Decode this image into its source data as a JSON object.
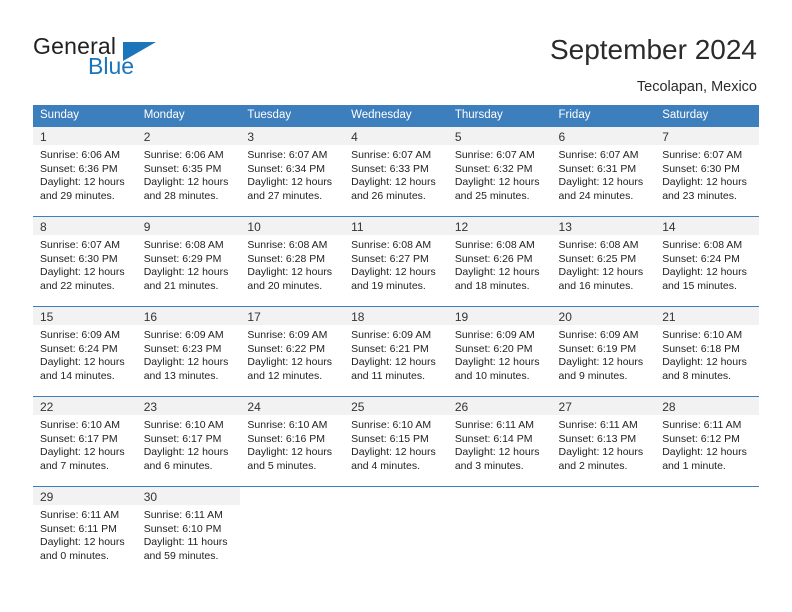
{
  "brand": {
    "name_top": "General",
    "name_bottom": "Blue",
    "triangle_color": "#1b75bb",
    "text_color": "#231f20"
  },
  "header": {
    "title": "September 2024",
    "subtitle": "Tecolapan, Mexico"
  },
  "theme": {
    "header_bg": "#3d7ebd",
    "header_text": "#ffffff",
    "daynum_band": "#f2f2f2",
    "row_divider": "#3d7ebd",
    "body_text": "#222222"
  },
  "weekdays": [
    "Sunday",
    "Monday",
    "Tuesday",
    "Wednesday",
    "Thursday",
    "Friday",
    "Saturday"
  ],
  "weeks": [
    [
      {
        "day": "1",
        "sunrise": "Sunrise: 6:06 AM",
        "sunset": "Sunset: 6:36 PM",
        "daylight1": "Daylight: 12 hours",
        "daylight2": "and 29 minutes."
      },
      {
        "day": "2",
        "sunrise": "Sunrise: 6:06 AM",
        "sunset": "Sunset: 6:35 PM",
        "daylight1": "Daylight: 12 hours",
        "daylight2": "and 28 minutes."
      },
      {
        "day": "3",
        "sunrise": "Sunrise: 6:07 AM",
        "sunset": "Sunset: 6:34 PM",
        "daylight1": "Daylight: 12 hours",
        "daylight2": "and 27 minutes."
      },
      {
        "day": "4",
        "sunrise": "Sunrise: 6:07 AM",
        "sunset": "Sunset: 6:33 PM",
        "daylight1": "Daylight: 12 hours",
        "daylight2": "and 26 minutes."
      },
      {
        "day": "5",
        "sunrise": "Sunrise: 6:07 AM",
        "sunset": "Sunset: 6:32 PM",
        "daylight1": "Daylight: 12 hours",
        "daylight2": "and 25 minutes."
      },
      {
        "day": "6",
        "sunrise": "Sunrise: 6:07 AM",
        "sunset": "Sunset: 6:31 PM",
        "daylight1": "Daylight: 12 hours",
        "daylight2": "and 24 minutes."
      },
      {
        "day": "7",
        "sunrise": "Sunrise: 6:07 AM",
        "sunset": "Sunset: 6:30 PM",
        "daylight1": "Daylight: 12 hours",
        "daylight2": "and 23 minutes."
      }
    ],
    [
      {
        "day": "8",
        "sunrise": "Sunrise: 6:07 AM",
        "sunset": "Sunset: 6:30 PM",
        "daylight1": "Daylight: 12 hours",
        "daylight2": "and 22 minutes."
      },
      {
        "day": "9",
        "sunrise": "Sunrise: 6:08 AM",
        "sunset": "Sunset: 6:29 PM",
        "daylight1": "Daylight: 12 hours",
        "daylight2": "and 21 minutes."
      },
      {
        "day": "10",
        "sunrise": "Sunrise: 6:08 AM",
        "sunset": "Sunset: 6:28 PM",
        "daylight1": "Daylight: 12 hours",
        "daylight2": "and 20 minutes."
      },
      {
        "day": "11",
        "sunrise": "Sunrise: 6:08 AM",
        "sunset": "Sunset: 6:27 PM",
        "daylight1": "Daylight: 12 hours",
        "daylight2": "and 19 minutes."
      },
      {
        "day": "12",
        "sunrise": "Sunrise: 6:08 AM",
        "sunset": "Sunset: 6:26 PM",
        "daylight1": "Daylight: 12 hours",
        "daylight2": "and 18 minutes."
      },
      {
        "day": "13",
        "sunrise": "Sunrise: 6:08 AM",
        "sunset": "Sunset: 6:25 PM",
        "daylight1": "Daylight: 12 hours",
        "daylight2": "and 16 minutes."
      },
      {
        "day": "14",
        "sunrise": "Sunrise: 6:08 AM",
        "sunset": "Sunset: 6:24 PM",
        "daylight1": "Daylight: 12 hours",
        "daylight2": "and 15 minutes."
      }
    ],
    [
      {
        "day": "15",
        "sunrise": "Sunrise: 6:09 AM",
        "sunset": "Sunset: 6:24 PM",
        "daylight1": "Daylight: 12 hours",
        "daylight2": "and 14 minutes."
      },
      {
        "day": "16",
        "sunrise": "Sunrise: 6:09 AM",
        "sunset": "Sunset: 6:23 PM",
        "daylight1": "Daylight: 12 hours",
        "daylight2": "and 13 minutes."
      },
      {
        "day": "17",
        "sunrise": "Sunrise: 6:09 AM",
        "sunset": "Sunset: 6:22 PM",
        "daylight1": "Daylight: 12 hours",
        "daylight2": "and 12 minutes."
      },
      {
        "day": "18",
        "sunrise": "Sunrise: 6:09 AM",
        "sunset": "Sunset: 6:21 PM",
        "daylight1": "Daylight: 12 hours",
        "daylight2": "and 11 minutes."
      },
      {
        "day": "19",
        "sunrise": "Sunrise: 6:09 AM",
        "sunset": "Sunset: 6:20 PM",
        "daylight1": "Daylight: 12 hours",
        "daylight2": "and 10 minutes."
      },
      {
        "day": "20",
        "sunrise": "Sunrise: 6:09 AM",
        "sunset": "Sunset: 6:19 PM",
        "daylight1": "Daylight: 12 hours",
        "daylight2": "and 9 minutes."
      },
      {
        "day": "21",
        "sunrise": "Sunrise: 6:10 AM",
        "sunset": "Sunset: 6:18 PM",
        "daylight1": "Daylight: 12 hours",
        "daylight2": "and 8 minutes."
      }
    ],
    [
      {
        "day": "22",
        "sunrise": "Sunrise: 6:10 AM",
        "sunset": "Sunset: 6:17 PM",
        "daylight1": "Daylight: 12 hours",
        "daylight2": "and 7 minutes."
      },
      {
        "day": "23",
        "sunrise": "Sunrise: 6:10 AM",
        "sunset": "Sunset: 6:17 PM",
        "daylight1": "Daylight: 12 hours",
        "daylight2": "and 6 minutes."
      },
      {
        "day": "24",
        "sunrise": "Sunrise: 6:10 AM",
        "sunset": "Sunset: 6:16 PM",
        "daylight1": "Daylight: 12 hours",
        "daylight2": "and 5 minutes."
      },
      {
        "day": "25",
        "sunrise": "Sunrise: 6:10 AM",
        "sunset": "Sunset: 6:15 PM",
        "daylight1": "Daylight: 12 hours",
        "daylight2": "and 4 minutes."
      },
      {
        "day": "26",
        "sunrise": "Sunrise: 6:11 AM",
        "sunset": "Sunset: 6:14 PM",
        "daylight1": "Daylight: 12 hours",
        "daylight2": "and 3 minutes."
      },
      {
        "day": "27",
        "sunrise": "Sunrise: 6:11 AM",
        "sunset": "Sunset: 6:13 PM",
        "daylight1": "Daylight: 12 hours",
        "daylight2": "and 2 minutes."
      },
      {
        "day": "28",
        "sunrise": "Sunrise: 6:11 AM",
        "sunset": "Sunset: 6:12 PM",
        "daylight1": "Daylight: 12 hours",
        "daylight2": "and 1 minute."
      }
    ],
    [
      {
        "day": "29",
        "sunrise": "Sunrise: 6:11 AM",
        "sunset": "Sunset: 6:11 PM",
        "daylight1": "Daylight: 12 hours",
        "daylight2": "and 0 minutes."
      },
      {
        "day": "30",
        "sunrise": "Sunrise: 6:11 AM",
        "sunset": "Sunset: 6:10 PM",
        "daylight1": "Daylight: 11 hours",
        "daylight2": "and 59 minutes."
      },
      null,
      null,
      null,
      null,
      null
    ]
  ]
}
